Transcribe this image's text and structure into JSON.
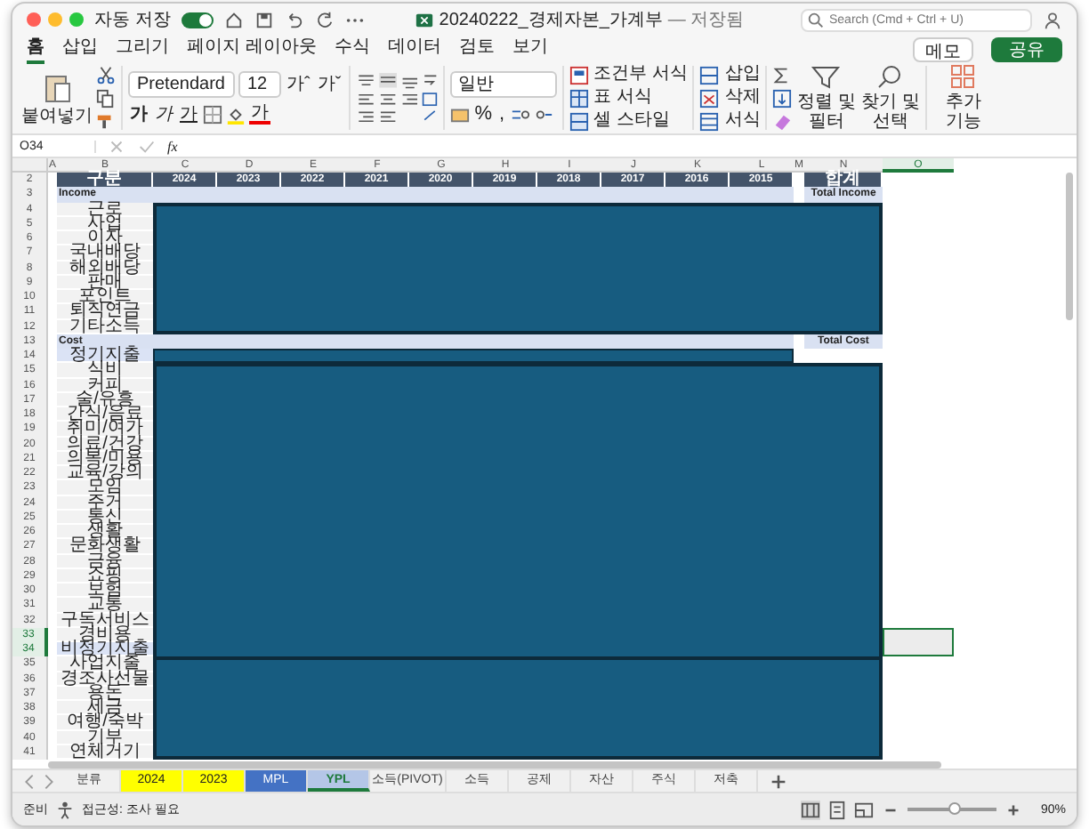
{
  "window": {
    "autosave_label": "자동 저장",
    "autosave_on": true,
    "title": "20240222_경제자본_가계부",
    "save_state": "— 저장됨",
    "search": {
      "placeholder": "Search (Cmd + Ctrl + U)"
    }
  },
  "ribbon_tabs": [
    {
      "label": "홈",
      "selected": true
    },
    {
      "label": "삽입",
      "selected": false
    },
    {
      "label": "그리기",
      "selected": false
    },
    {
      "label": "페이지 레이아웃",
      "selected": false
    },
    {
      "label": "수식",
      "selected": false
    },
    {
      "label": "데이터",
      "selected": false
    },
    {
      "label": "검토",
      "selected": false
    },
    {
      "label": "보기",
      "selected": false
    }
  ],
  "ribbon_actions": {
    "memo": "메모",
    "share": "공유"
  },
  "ribbon": {
    "paste": "붙여넣기",
    "font": "Pretendard",
    "size": "12",
    "grow": "가ˆ",
    "shrink": "가ˇ",
    "font_styles": [
      "가",
      "가",
      "가"
    ],
    "font_color": "가",
    "number_format": "일반",
    "percent": "%",
    "comma": ",",
    "conditional": "조건부 서식",
    "table_format": "표 서식",
    "cell_style": "셀 스타일",
    "insert": "삽입",
    "delete": "삭제",
    "format": "서식",
    "sort": "정렬 및 필터",
    "find": "찾기 및 선택",
    "addins": "추가 기능"
  },
  "formula_bar": {
    "cell_ref": "O34",
    "fx": "fx"
  },
  "sheet": {
    "columns": [
      {
        "label": "A",
        "selected": false
      },
      {
        "label": "B",
        "selected": false
      },
      {
        "label": "C",
        "selected": false
      },
      {
        "label": "D",
        "selected": false
      },
      {
        "label": "E",
        "selected": false
      },
      {
        "label": "F",
        "selected": false
      },
      {
        "label": "G",
        "selected": false
      },
      {
        "label": "H",
        "selected": false
      },
      {
        "label": "I",
        "selected": false
      },
      {
        "label": "J",
        "selected": false
      },
      {
        "label": "K",
        "selected": false
      },
      {
        "label": "L",
        "selected": false
      },
      {
        "label": "M",
        "selected": false
      },
      {
        "label": "N",
        "selected": false
      },
      {
        "label": "O",
        "selected": true
      }
    ],
    "row_numbers": [
      {
        "label": "2",
        "selected": false
      },
      {
        "label": "3",
        "selected": false
      },
      {
        "label": "4",
        "selected": false
      },
      {
        "label": "5",
        "selected": false
      },
      {
        "label": "6",
        "selected": false
      },
      {
        "label": "7",
        "selected": false
      },
      {
        "label": "8",
        "selected": false
      },
      {
        "label": "9",
        "selected": false
      },
      {
        "label": "10",
        "selected": false
      },
      {
        "label": "11",
        "selected": false
      },
      {
        "label": "12",
        "selected": false
      },
      {
        "label": "13",
        "selected": false
      },
      {
        "label": "14",
        "selected": false
      },
      {
        "label": "15",
        "selected": false
      },
      {
        "label": "16",
        "selected": false
      },
      {
        "label": "17",
        "selected": false
      },
      {
        "label": "18",
        "selected": false
      },
      {
        "label": "19",
        "selected": false
      },
      {
        "label": "20",
        "selected": false
      },
      {
        "label": "21",
        "selected": false
      },
      {
        "label": "22",
        "selected": false
      },
      {
        "label": "23",
        "selected": false
      },
      {
        "label": "24",
        "selected": false
      },
      {
        "label": "25",
        "selected": false
      },
      {
        "label": "26",
        "selected": false
      },
      {
        "label": "27",
        "selected": false
      },
      {
        "label": "28",
        "selected": false
      },
      {
        "label": "29",
        "selected": false
      },
      {
        "label": "30",
        "selected": false
      },
      {
        "label": "31",
        "selected": false
      },
      {
        "label": "32",
        "selected": false
      },
      {
        "label": "33",
        "selected": true
      },
      {
        "label": "34",
        "selected": true
      },
      {
        "label": "35",
        "selected": false
      },
      {
        "label": "36",
        "selected": false
      },
      {
        "label": "37",
        "selected": false
      },
      {
        "label": "38",
        "selected": false
      },
      {
        "label": "39",
        "selected": false
      },
      {
        "label": "40",
        "selected": false
      },
      {
        "label": "41",
        "selected": false
      }
    ],
    "header": [
      "구분",
      "2024",
      "2023",
      "2022",
      "2021",
      "2020",
      "2019",
      "2018",
      "2017",
      "2016",
      "2015"
    ],
    "total_header": "합계",
    "sections": [
      {
        "title": "Income",
        "total_label": "Total Income",
        "items": [
          {
            "label": "근로",
            "kind": "item"
          },
          {
            "label": "사업",
            "kind": "item"
          },
          {
            "label": "이자",
            "kind": "item"
          },
          {
            "label": "국내배당",
            "kind": "item"
          },
          {
            "label": "해외배당",
            "kind": "item"
          },
          {
            "label": "판매",
            "kind": "item"
          },
          {
            "label": "포인트",
            "kind": "item"
          },
          {
            "label": "퇴직연금",
            "kind": "item"
          },
          {
            "label": "기타소득",
            "kind": "item"
          }
        ]
      },
      {
        "title": "Cost",
        "total_label": "Total Cost",
        "items": [
          {
            "label": "정기지출",
            "kind": "subgroup"
          },
          {
            "label": "식비",
            "kind": "item"
          },
          {
            "label": "커피",
            "kind": "item"
          },
          {
            "label": "술/유흥",
            "kind": "item"
          },
          {
            "label": "간식/음료",
            "kind": "item"
          },
          {
            "label": "취미/여가",
            "kind": "item"
          },
          {
            "label": "의료/건강",
            "kind": "item"
          },
          {
            "label": "의복/미용",
            "kind": "item"
          },
          {
            "label": "교육/강의",
            "kind": "item"
          },
          {
            "label": "모임",
            "kind": "item"
          },
          {
            "label": "주거",
            "kind": "item"
          },
          {
            "label": "통신",
            "kind": "item"
          },
          {
            "label": "생활",
            "kind": "item"
          },
          {
            "label": "문화생활",
            "kind": "item"
          },
          {
            "label": "금융",
            "kind": "item"
          },
          {
            "label": "쇼핑",
            "kind": "item"
          },
          {
            "label": "보험",
            "kind": "item"
          },
          {
            "label": "교통",
            "kind": "item"
          },
          {
            "label": "구독서비스",
            "kind": "item"
          },
          {
            "label": "경비용",
            "kind": "item"
          },
          {
            "label": "비정기지출",
            "kind": "subgroup"
          },
          {
            "label": "사업지출",
            "kind": "item"
          },
          {
            "label": "경조사선물",
            "kind": "item"
          },
          {
            "label": "용돈",
            "kind": "item"
          },
          {
            "label": "세금",
            "kind": "item"
          },
          {
            "label": "여행/숙박",
            "kind": "item"
          },
          {
            "label": "기부",
            "kind": "item"
          },
          {
            "label": "연체거기",
            "kind": "item"
          }
        ]
      }
    ]
  },
  "sheet_tabs": [
    {
      "label": "분류",
      "selected": false
    },
    {
      "label": "2024",
      "selected": false,
      "color": "#ffff00"
    },
    {
      "label": "2023",
      "selected": false,
      "color": "#ffff00"
    },
    {
      "label": "MPL",
      "selected": false,
      "color": "#4472c4"
    },
    {
      "label": "YPL",
      "selected": true,
      "color": "#b4c6e7"
    },
    {
      "label": "소득(PIVOT)",
      "selected": false
    },
    {
      "label": "소득",
      "selected": false
    },
    {
      "label": "공제",
      "selected": false
    },
    {
      "label": "자산",
      "selected": false
    },
    {
      "label": "주식",
      "selected": false
    },
    {
      "label": "저축",
      "selected": false
    }
  ],
  "status_bar": {
    "ready": "준비",
    "accessibility": "접근성: 조사 필요",
    "zoom": {
      "level": 0.55,
      "reading": "90%"
    }
  }
}
